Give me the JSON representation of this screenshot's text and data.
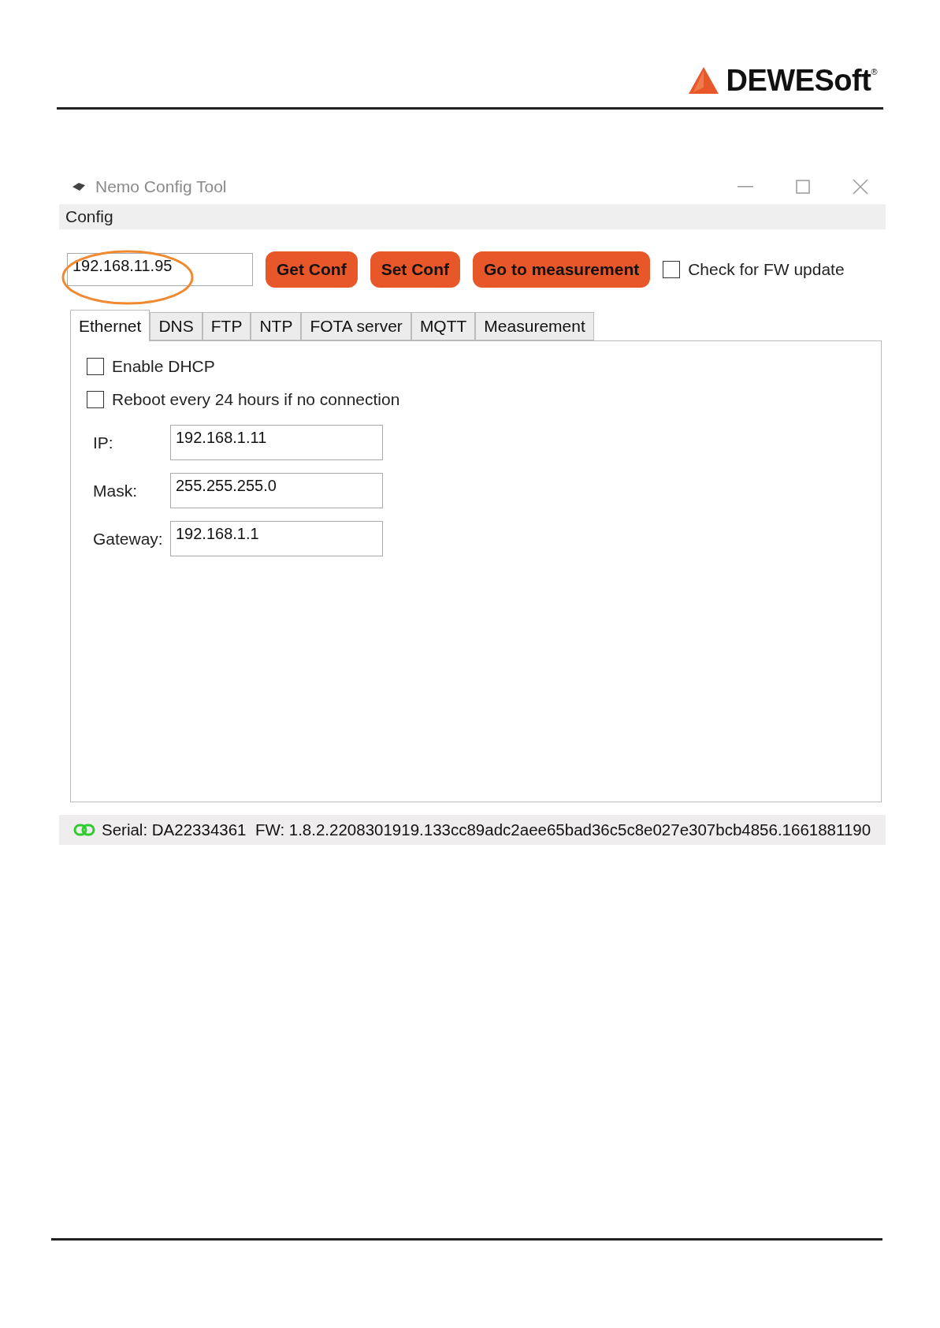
{
  "header": {
    "logo_text": "DEWESoft",
    "logo_mark": "®"
  },
  "window": {
    "title": "Nemo Config Tool"
  },
  "menu": [
    "Config"
  ],
  "toolbar": {
    "address": "192.168.11.95",
    "buttons": [
      "Get Conf",
      "Set Conf",
      "Go to measurement"
    ],
    "fw_update": {
      "label": "Check for FW update",
      "checked": false
    }
  },
  "tabs": [
    {
      "label": "Ethernet",
      "selected": true
    },
    {
      "label": "DNS",
      "selected": false
    },
    {
      "label": "FTP",
      "selected": false
    },
    {
      "label": "NTP",
      "selected": false
    },
    {
      "label": "FOTA server",
      "selected": false
    },
    {
      "label": "MQTT",
      "selected": false
    },
    {
      "label": "Measurement",
      "selected": false
    }
  ],
  "options": [
    {
      "label": "Enable DHCP",
      "checked": false
    },
    {
      "label": "Reboot every 24 hours if no connection",
      "checked": false
    }
  ],
  "fields": [
    {
      "label": "IP:",
      "value": "192.168.1.11"
    },
    {
      "label": "Mask:",
      "value": "255.255.255.0"
    },
    {
      "label": "Gateway:",
      "value": "192.168.1.1"
    }
  ],
  "status_bar": {
    "connected": true,
    "text": "Serial: DA22334361  FW: 1.8.2.2208301919.133cc89adc2aee65bad36c5c8e027e307bcb4856.1661881190"
  }
}
